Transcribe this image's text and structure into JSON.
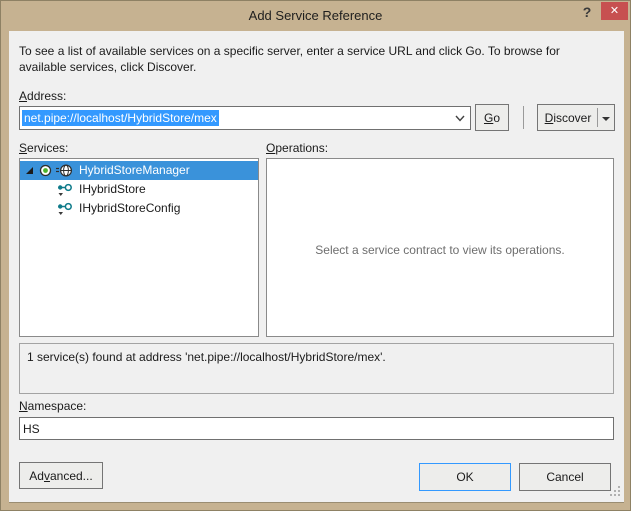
{
  "window": {
    "title": "Add Service Reference",
    "help": "?",
    "close": "✕"
  },
  "intro": "To see a list of available services on a specific server, enter a service URL and click Go. To browse for available services, click Discover.",
  "address": {
    "label": {
      "key": "A",
      "rest": "ddress:"
    },
    "value": "net.pipe://localhost/HybridStore/mex",
    "go": {
      "key": "G",
      "rest": "o"
    },
    "discover": {
      "key": "D",
      "rest": "iscover"
    }
  },
  "services": {
    "label": {
      "key": "S",
      "rest": "ervices:"
    },
    "items": [
      {
        "label": "HybridStoreManager",
        "type": "service",
        "selected": true,
        "expanded": true
      },
      {
        "label": "IHybridStore",
        "type": "contract"
      },
      {
        "label": "IHybridStoreConfig",
        "type": "contract"
      }
    ]
  },
  "operations": {
    "label": {
      "key": "O",
      "rest": "perations:"
    },
    "placeholder": "Select a service contract to view its operations."
  },
  "status": "1 service(s) found at address 'net.pipe://localhost/HybridStore/mex'.",
  "namespace": {
    "label": {
      "key": "N",
      "rest": "amespace:"
    },
    "value": "HS"
  },
  "footer": {
    "advanced": {
      "pre": "Ad",
      "key": "v",
      "post": "anced..."
    },
    "ok": "OK",
    "cancel": "Cancel"
  },
  "colors": {
    "titlebar": "#c6b291",
    "close_button": "#c75050",
    "text_selection": "#3399ff",
    "tree_selection": "#3a92da",
    "ok_border": "#3399ff",
    "client_bg": "#f0f0f0"
  }
}
